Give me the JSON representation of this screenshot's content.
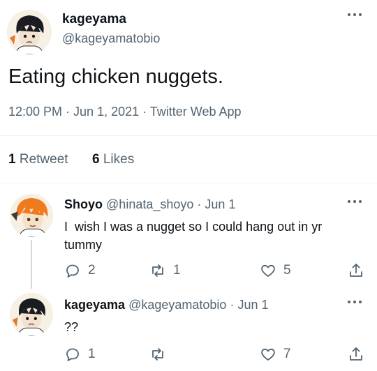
{
  "main_tweet": {
    "display_name": "kageyama",
    "handle": "@kageyamatobio",
    "text": "Eating chicken nuggets.",
    "meta": "12:00 PM · Jun 1, 2021 · Twitter Web App",
    "retweet_count": "1",
    "retweet_label": "Retweet",
    "like_count": "6",
    "like_label": "Likes"
  },
  "replies": [
    {
      "display_name": "Shoyo",
      "handle_date": "@hinata_shoyo · Jun 1",
      "text_line1": "I  wish I was a nugget so I could hang out in yr",
      "text_line2": "tummy",
      "reply_count": "2",
      "retweet_count": "1",
      "like_count": "5"
    },
    {
      "display_name": "kageyama",
      "handle_date": "@kageyamatobio · Jun 1",
      "text_line1": "??",
      "reply_count": "1",
      "retweet_count": "",
      "like_count": "7"
    }
  ],
  "icons": [
    "more-icon",
    "reply-icon",
    "retweet-icon",
    "like-icon",
    "share-icon"
  ],
  "colors": {
    "text": "#0f1419",
    "muted": "#536471",
    "divider": "#eff3f4",
    "thread_line": "#cfd9de"
  }
}
